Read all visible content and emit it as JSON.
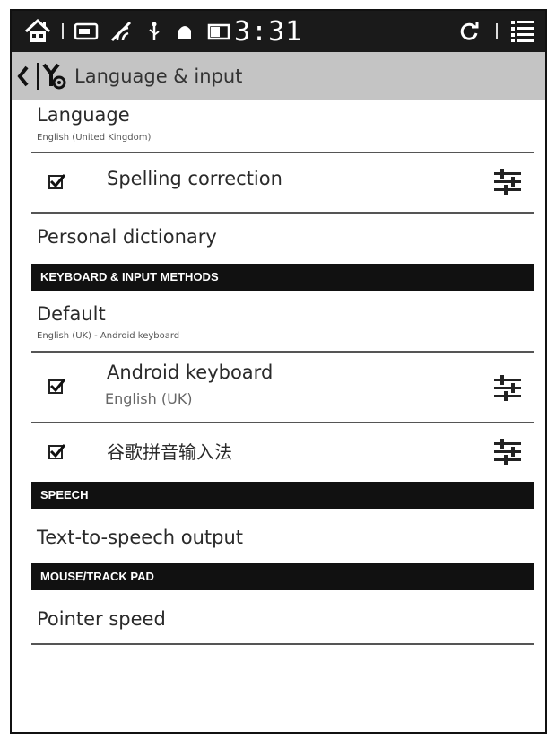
{
  "status_bar": {
    "icons": [
      "home-icon",
      "sd-card-icon",
      "wifi-signal-icon",
      "usb-icon",
      "android-debug-icon",
      "battery-icon",
      "sync-icon",
      "menu-icon"
    ],
    "time": "3:31"
  },
  "action_bar": {
    "title": "Language & input",
    "icons": [
      "back-chevron-icon",
      "settings-app-icon"
    ]
  },
  "items": {
    "language": {
      "title": "Language",
      "subtitle": "English (United Kingdom)"
    },
    "spelling": {
      "title": "Spelling correction",
      "checked": true
    },
    "personal_dictionary": {
      "title": "Personal dictionary"
    },
    "keyboard_header": "KEYBOARD & INPUT METHODS",
    "default": {
      "title": "Default",
      "subtitle": "English (UK) - Android keyboard"
    },
    "android_keyboard": {
      "title": "Android keyboard",
      "subtitle": "English (UK)",
      "checked": true
    },
    "pinyin": {
      "title": "谷歌拼音输入法",
      "checked": true
    },
    "speech_header": "SPEECH",
    "tts": {
      "title": "Text-to-speech output"
    },
    "mouse_header": "MOUSE/TRACK PAD",
    "pointer_speed": {
      "title": "Pointer speed"
    }
  }
}
